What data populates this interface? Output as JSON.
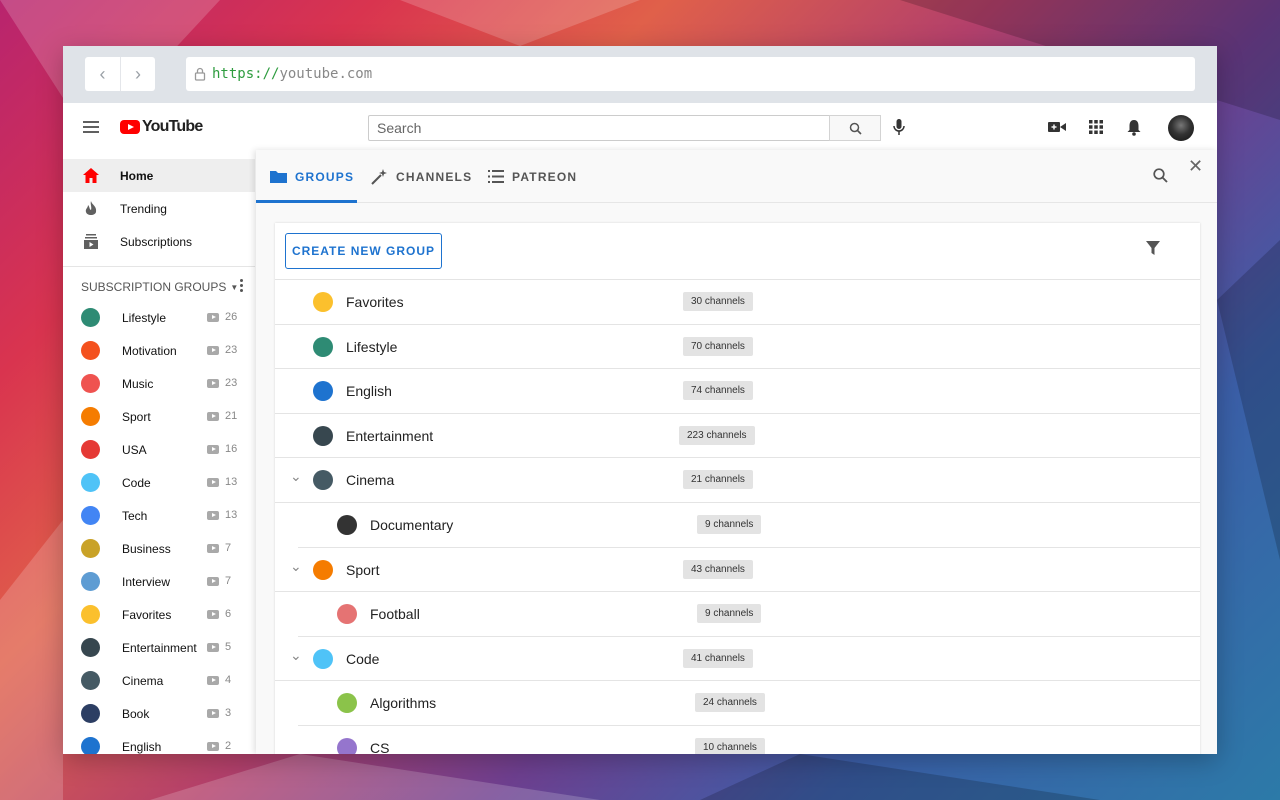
{
  "browser": {
    "url_scheme": "https://",
    "url_host": "youtube.com"
  },
  "header": {
    "logo_text": "YouTube",
    "search_placeholder": "Search"
  },
  "sidebar": {
    "main": [
      {
        "label": "Home",
        "icon": "home-icon",
        "active": true
      },
      {
        "label": "Trending",
        "icon": "fire-icon",
        "active": false
      },
      {
        "label": "Subscriptions",
        "icon": "subscriptions-icon",
        "active": false
      }
    ],
    "groups_title": "SUBSCRIPTION GROUPS",
    "groups": [
      {
        "label": "Lifestyle",
        "count": "26",
        "icon": "lightbulb-green-icon",
        "color": "#2e8b74"
      },
      {
        "label": "Motivation",
        "count": "23",
        "icon": "trend-up-icon",
        "color": "#f4511e"
      },
      {
        "label": "Music",
        "count": "23",
        "icon": "music-note-icon",
        "color": "#ef5350"
      },
      {
        "label": "Sport",
        "count": "21",
        "icon": "basketball-icon",
        "color": "#f57c00"
      },
      {
        "label": "USA",
        "count": "16",
        "icon": "usa-flag-icon",
        "color": "#e53935"
      },
      {
        "label": "Code",
        "count": "13",
        "icon": "code-cup-icon",
        "color": "#4fc3f7"
      },
      {
        "label": "Tech",
        "count": "13",
        "icon": "google-g-icon",
        "color": "#4285f4"
      },
      {
        "label": "Business",
        "count": "7",
        "icon": "money-bag-icon",
        "color": "#c9a227"
      },
      {
        "label": "Interview",
        "count": "7",
        "icon": "microphone-icon",
        "color": "#5e9cd3"
      },
      {
        "label": "Favorites",
        "count": "6",
        "icon": "lightbulb-yellow-icon",
        "color": "#fbc02d"
      },
      {
        "label": "Entertainment",
        "count": "5",
        "icon": "3d-glasses-icon",
        "color": "#37474f"
      },
      {
        "label": "Cinema",
        "count": "4",
        "icon": "film-icon",
        "color": "#455a64"
      },
      {
        "label": "Book",
        "count": "3",
        "icon": "graduation-cap-icon",
        "color": "#2c3e63"
      },
      {
        "label": "English",
        "count": "2",
        "icon": "translate-icon",
        "color": "#1e73cf"
      }
    ]
  },
  "panel": {
    "tabs": [
      {
        "label": "GROUPS",
        "icon": "folder-icon",
        "active": true
      },
      {
        "label": "CHANNELS",
        "icon": "magic-wand-icon",
        "active": false
      },
      {
        "label": "PATREON",
        "icon": "list-icon",
        "active": false
      }
    ],
    "create_button": "CREATE NEW GROUP",
    "groups": [
      {
        "name": "Favorites",
        "badge": "30 channels",
        "icon": "lightbulb-yellow-icon",
        "color": "#fbc02d",
        "child": false,
        "expandable": false
      },
      {
        "name": "Lifestyle",
        "badge": "70 channels",
        "icon": "lightbulb-green-icon",
        "color": "#2e8b74",
        "child": false,
        "expandable": false
      },
      {
        "name": "English",
        "badge": "74 channels",
        "icon": "translate-icon",
        "color": "#1e73cf",
        "child": false,
        "expandable": false
      },
      {
        "name": "Entertainment",
        "badge": "223 channels",
        "icon": "3d-glasses-icon",
        "color": "#37474f",
        "child": false,
        "expandable": false
      },
      {
        "name": "Cinema",
        "badge": "21 channels",
        "icon": "film-icon",
        "color": "#455a64",
        "child": false,
        "expandable": true
      },
      {
        "name": "Documentary",
        "badge": "9 channels",
        "icon": "clapperboard-icon",
        "color": "#333333",
        "child": true,
        "expandable": false
      },
      {
        "name": "Sport",
        "badge": "43 channels",
        "icon": "basketball-icon",
        "color": "#f57c00",
        "child": false,
        "expandable": true
      },
      {
        "name": "Football",
        "badge": "9 channels",
        "icon": "soccer-player-icon",
        "color": "#e57373",
        "child": true,
        "expandable": false
      },
      {
        "name": "Code",
        "badge": "41 channels",
        "icon": "code-cup-icon",
        "color": "#4fc3f7",
        "child": false,
        "expandable": true
      },
      {
        "name": "Algorithms",
        "badge": "24 channels",
        "icon": "brain-green-icon",
        "color": "#8bc34a",
        "child": true,
        "expandable": false
      },
      {
        "name": "CS",
        "badge": "10 channels",
        "icon": "brain-purple-icon",
        "color": "#9575cd",
        "child": true,
        "expandable": false
      }
    ]
  },
  "colors": {
    "accent": "#1e73cf",
    "youtube_red": "#ff0000"
  }
}
